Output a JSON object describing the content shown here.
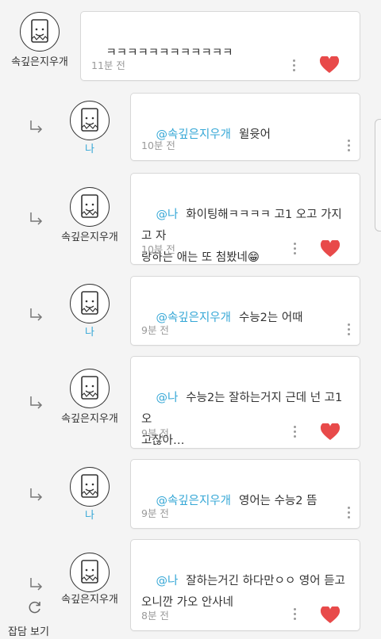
{
  "colors": {
    "accent": "#35a7d6",
    "heart": "#e84a4a",
    "text": "#333333",
    "muted": "#9a9a9a"
  },
  "icons": {
    "reply": "reply-arrow-icon",
    "more": "more-vertical-icon",
    "like": "heart-icon",
    "refresh": "refresh-icon"
  },
  "comments": [
    {
      "author": "속깊은지우개",
      "mention": "",
      "text": "ㅋㅋㅋㅋㅋㅋㅋㅋㅋㅋㅋㅋ",
      "time": "11분 전",
      "liked": true
    },
    {
      "author": "나",
      "mention": "@속깊은지우개",
      "text": "윌윳어",
      "time": "10분 전",
      "liked": false
    },
    {
      "author": "속깊은지우개",
      "mention": "@나",
      "text": "화이팅해ㅋㅋㅋㅋ 고1 오고 가지고 자\n랑하는 애는 또 첨봤네😁",
      "time": "10분 전",
      "liked": true
    },
    {
      "author": "나",
      "mention": "@속깊은지우개",
      "text": "수능2는 어때",
      "time": "9분 전",
      "liked": false
    },
    {
      "author": "속깊은지우개",
      "mention": "@나",
      "text": "수능2는 잘하는거지 근데 넌 고1오\n고잖아…",
      "time": "9분 전",
      "liked": true
    },
    {
      "author": "나",
      "mention": "@속깊은지우개",
      "text": "영어는 수능2 뜸",
      "time": "9분 전",
      "liked": false
    },
    {
      "author": "속깊은지우개",
      "mention": "@나",
      "text": "잘하는거긴 하다만ㅇㅇ 영어 듣고\n오니깐 가오 안사네",
      "time": "8분 전",
      "liked": true
    }
  ],
  "footer": {
    "view_thread_label": "잡담 보기"
  }
}
